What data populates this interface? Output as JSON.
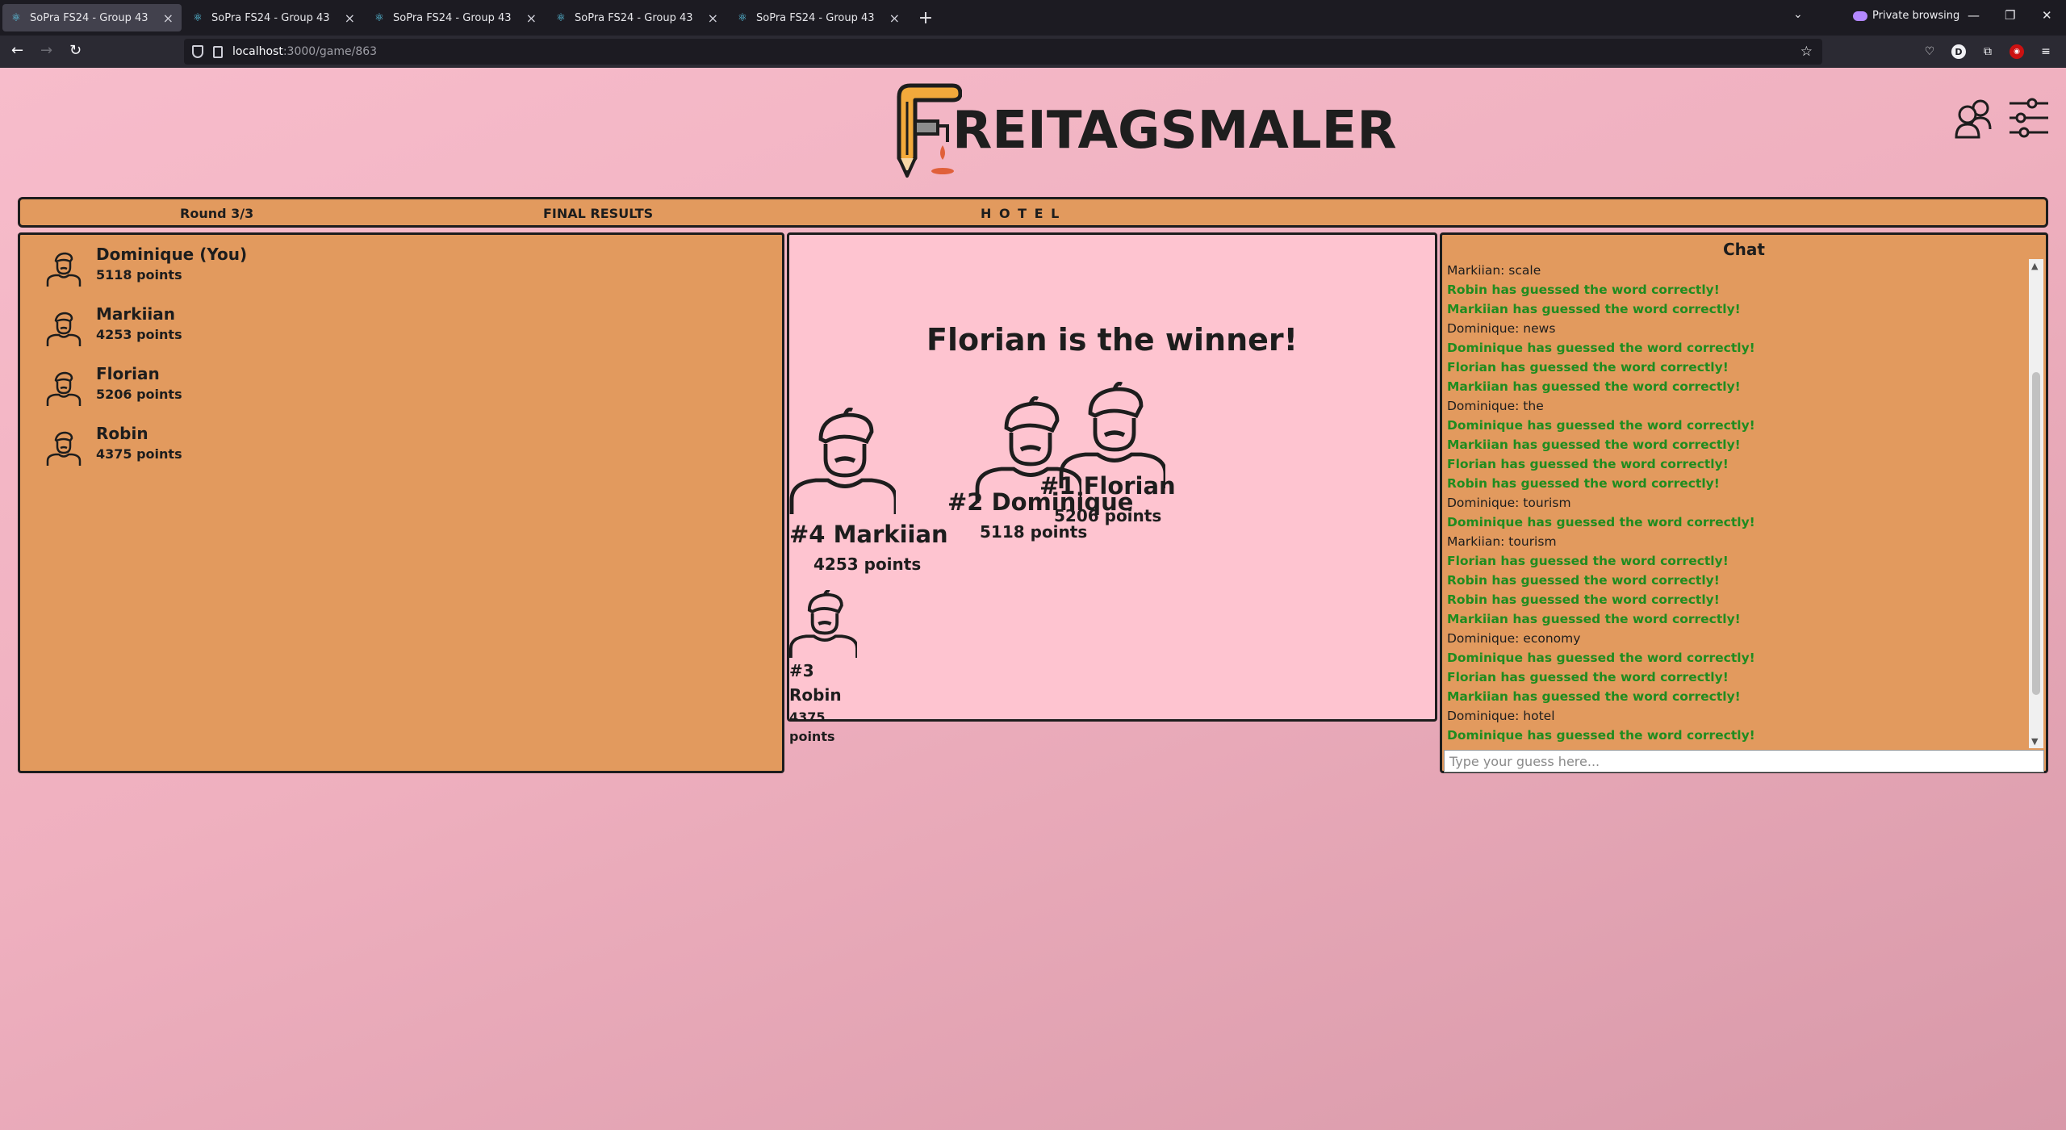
{
  "browser": {
    "tabs": [
      {
        "title": "SoPra FS24 - Group 43",
        "active": true
      },
      {
        "title": "SoPra FS24 - Group 43",
        "active": false
      },
      {
        "title": "SoPra FS24 - Group 43",
        "active": false
      },
      {
        "title": "SoPra FS24 - Group 43",
        "active": false
      },
      {
        "title": "SoPra FS24 - Group 43",
        "active": false
      }
    ],
    "private_label": "Private browsing",
    "url_host": "localhost",
    "url_path": ":3000/game/863"
  },
  "app": {
    "logo_text": "REITAGSMALER"
  },
  "infobar": {
    "round": "Round 3/3",
    "phase": "FINAL RESULTS",
    "word": "H O T E L"
  },
  "players": [
    {
      "name": "Dominique (You)",
      "points": "5118 points"
    },
    {
      "name": "Markiian",
      "points": "4253 points"
    },
    {
      "name": "Florian",
      "points": "5206 points"
    },
    {
      "name": "Robin",
      "points": "4375 points"
    }
  ],
  "results": {
    "winner_text": "Florian is the winner!",
    "podium": [
      {
        "rank_name": "#4 Markiian",
        "points": "4253 points"
      },
      {
        "rank_name": "#2 Dominique",
        "points": "5118 points"
      },
      {
        "rank_name": "#1 Florian",
        "points": "5206 points"
      },
      {
        "rank": "#3",
        "name": "Robin",
        "points_num": "4375",
        "points_word": "points"
      }
    ]
  },
  "chat": {
    "title": "Chat",
    "placeholder": "Type your guess here...",
    "messages": [
      {
        "text": "Markiian: scale",
        "type": "plain"
      },
      {
        "text": "Robin has guessed the word correctly!",
        "type": "guess"
      },
      {
        "text": "Markiian has guessed the word correctly!",
        "type": "guess"
      },
      {
        "text": "Dominique: news",
        "type": "plain"
      },
      {
        "text": "Dominique has guessed the word correctly!",
        "type": "guess"
      },
      {
        "text": "Florian has guessed the word correctly!",
        "type": "guess"
      },
      {
        "text": "Markiian has guessed the word correctly!",
        "type": "guess"
      },
      {
        "text": "Dominique: the",
        "type": "plain"
      },
      {
        "text": "Dominique has guessed the word correctly!",
        "type": "guess"
      },
      {
        "text": "Markiian has guessed the word correctly!",
        "type": "guess"
      },
      {
        "text": "Florian has guessed the word correctly!",
        "type": "guess"
      },
      {
        "text": "Robin has guessed the word correctly!",
        "type": "guess"
      },
      {
        "text": "Dominique: tourism",
        "type": "plain"
      },
      {
        "text": "Dominique has guessed the word correctly!",
        "type": "guess"
      },
      {
        "text": "Markiian: tourism",
        "type": "plain"
      },
      {
        "text": "Florian has guessed the word correctly!",
        "type": "guess"
      },
      {
        "text": "Robin has guessed the word correctly!",
        "type": "guess"
      },
      {
        "text": "Robin has guessed the word correctly!",
        "type": "guess"
      },
      {
        "text": "Markiian has guessed the word correctly!",
        "type": "guess"
      },
      {
        "text": "Dominique: economy",
        "type": "plain"
      },
      {
        "text": "Dominique has guessed the word correctly!",
        "type": "guess"
      },
      {
        "text": "Florian has guessed the word correctly!",
        "type": "guess"
      },
      {
        "text": "Markiian has guessed the word correctly!",
        "type": "guess"
      },
      {
        "text": "Dominique: hotel",
        "type": "plain"
      },
      {
        "text": "Dominique has guessed the word correctly!",
        "type": "guess"
      }
    ]
  }
}
